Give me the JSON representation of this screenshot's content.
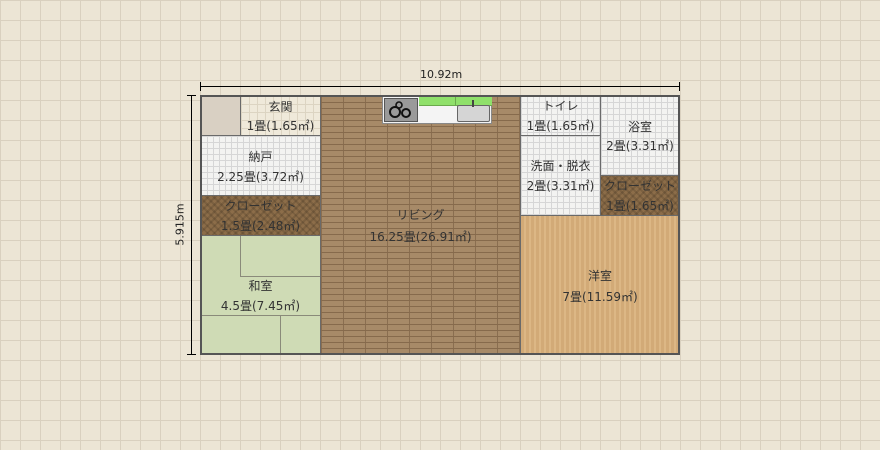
{
  "dimensions": {
    "width": "10.92m",
    "height": "5.915m"
  },
  "rooms": {
    "genkan": {
      "name": "玄関",
      "size": "1畳(1.65㎡)"
    },
    "nando": {
      "name": "納戸",
      "size": "2.25畳(3.72㎡)"
    },
    "closet_left": {
      "name": "クローゼット",
      "size": "1.5畳(2.48㎡)"
    },
    "washitsu": {
      "name": "和室",
      "size": "4.5畳(7.45㎡)"
    },
    "living": {
      "name": "リビング",
      "size": "16.25畳(26.91㎡)"
    },
    "toilet": {
      "name": "トイレ",
      "size": "1畳(1.65㎡)"
    },
    "bath": {
      "name": "浴室",
      "size": "2畳(3.31㎡)"
    },
    "washroom": {
      "name": "洗面・脱衣",
      "size": "2畳(3.31㎡)"
    },
    "closet_right": {
      "name": "クローゼット",
      "size": "1畳(1.65㎡)"
    },
    "youshitsu": {
      "name": "洋室",
      "size": "7畳(11.59㎡)"
    }
  },
  "kitchen": {
    "items": [
      "stove-icon",
      "counter",
      "sink-icon"
    ]
  }
}
